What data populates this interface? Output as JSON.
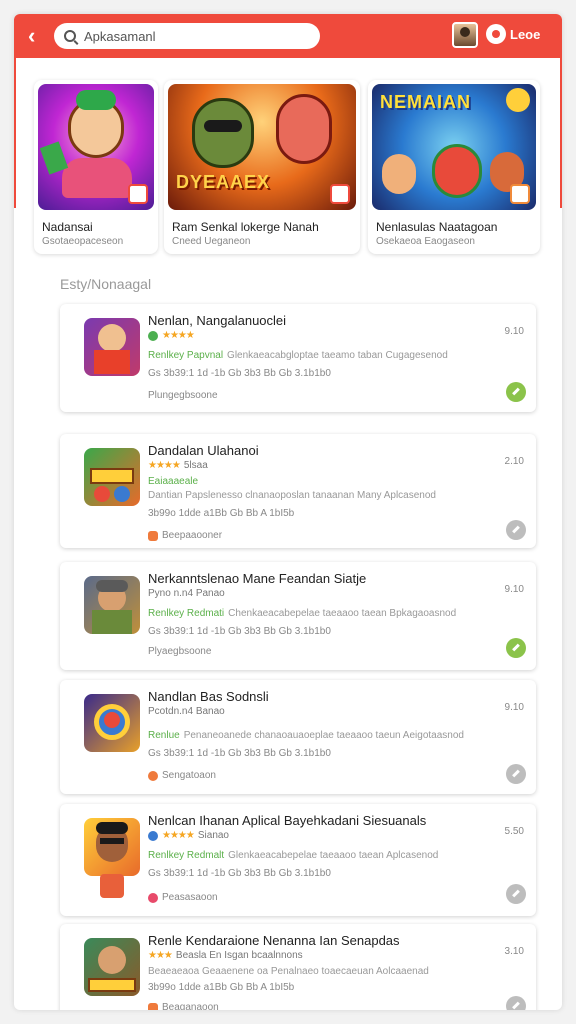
{
  "header": {
    "search_text": "Apkasamanl",
    "brand": "Leoe"
  },
  "featured": [
    {
      "title": "Nadansai",
      "subtitle": "Gsotaeopaceseon",
      "banner_text": ""
    },
    {
      "title": "Ram Senkal lokerge Nanah",
      "subtitle": "Cneed  Ueganeon",
      "banner_text": "DYEAAEX"
    },
    {
      "title": "Nenlasulas Naatagoan",
      "subtitle": "Osekaeoa  Eaogaseon",
      "banner_text": "NEMAIAN"
    }
  ],
  "section_title": "Esty/Nonaagal",
  "items": [
    {
      "name": "Nenlan, Nangalanuoclei",
      "rating_text": "",
      "tag_label": "Renlkey Papvnal",
      "tag_text": "Glenkaeacabgloptae taeamo taban Cugagesenod",
      "stats": "Gs 3b39:1 1d -1b  Gb 3b3  Bb  Gb 3.1b1b0",
      "category": "Plungegbsoone",
      "price": "",
      "version": "9.10",
      "download_green": true
    },
    {
      "name": "Dandalan Ulahanoi",
      "rating_text": "5lsaa",
      "tag_label": "Eaiaaaeale",
      "tag_text": "Dantian  Papslenesso clnanaoposlan tanaanan Many Aplcasenod",
      "stats": "3b99o 1dde  a1Bb Gb  Bb  A 1bI5b",
      "category": "Beepaaooner",
      "price": "",
      "version": "2.10",
      "download_green": false
    },
    {
      "name": "Nerkanntslenao Mane Feandan Siatje",
      "rating_text": "Pyno n.n4  Panao",
      "tag_label": "Renlkey Redmati",
      "tag_text": "Chenkaeacabepelae taeaaoo taean Bpkagaoasnod",
      "stats": "Gs 3b39:1 1d -1b  Gb 3b3  Bb  Gb 3.1b1b0",
      "category": "Plyaegbsoone",
      "price": "",
      "version": "9.10",
      "download_green": true
    },
    {
      "name": "Nandlan Bas Sodnsli",
      "rating_text": "Pcotdn.n4  Banao",
      "tag_label": "Renlue",
      "tag_text": "Penaneoanede chanaoauaoeplae taeaaoo taeun Aeigotaasnod",
      "stats": "Gs 3b39:1 1d -1b  Gb 3b3  Bb  Gb 3.1b1b0",
      "category": "Sengatoaon",
      "price": "",
      "version": "9.10",
      "download_green": false
    },
    {
      "name": "Nenlcan Ihanan Aplical Bayehkadani Siesuanals",
      "rating_text": "Sianao",
      "tag_label": "Renlkey Redmalt",
      "tag_text": "Glenkaeacabepelae taeaaoo taean Aplcasenod",
      "stats": "Gs 3b39:1 1d -1b  Gb 3b3  Bb  Gb 3.1b1b0",
      "category": "Peasasaoon",
      "price": "",
      "version": "5.50",
      "download_green": false
    },
    {
      "name": "Renle Kendaraione Nenanna Ian Senapdas",
      "rating_text": "Beasla  En Isgan  bcaalnnons",
      "tag_label": "",
      "tag_text": "Beaeaeaoa Geaaenene oa Penalnaeo toaecaeuan  Aolcaaenad",
      "stats": "3b99o 1dde  a1Bb Gb  Bb  A 1bI5b",
      "category": "Beaganaoon",
      "price": "",
      "version": "3.10",
      "download_green": false
    }
  ],
  "colors": {
    "accent": "#ef4a3c",
    "rating": "#f5a623",
    "tag_green": "#5bb04a"
  }
}
